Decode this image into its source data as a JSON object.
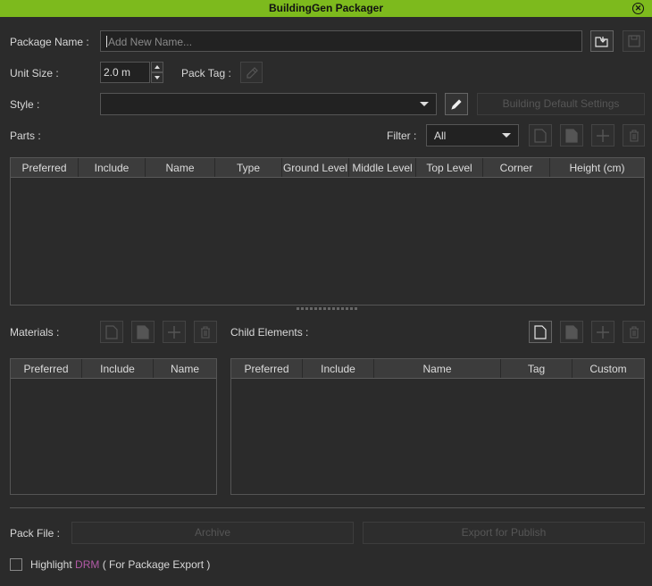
{
  "window": {
    "title": "BuildingGen Packager"
  },
  "package_name": {
    "label": "Package Name :",
    "placeholder": "Add New Name..."
  },
  "unit_size": {
    "label": "Unit Size :",
    "value": "2.0 m"
  },
  "pack_tag": {
    "label": "Pack Tag :"
  },
  "style": {
    "label": "Style :",
    "value": ""
  },
  "building_default_settings": {
    "label": "Building Default Settings"
  },
  "parts": {
    "label": "Parts :",
    "filter_label": "Filter :",
    "filter_value": "All",
    "columns": [
      "Preferred",
      "Include",
      "Name",
      "Type",
      "Ground Level",
      "Middle Level",
      "Top Level",
      "Corner",
      "Height (cm)"
    ]
  },
  "materials": {
    "label": "Materials :",
    "columns": [
      "Preferred",
      "Include",
      "Name"
    ]
  },
  "child_elements": {
    "label": "Child Elements :",
    "columns": [
      "Preferred",
      "Include",
      "Name",
      "Tag",
      "Custom"
    ]
  },
  "pack_file": {
    "label": "Pack File :",
    "archive_label": "Archive",
    "export_label": "Export for Publish"
  },
  "highlight": {
    "prefix": "Highlight ",
    "drm": "DRM",
    "suffix": " ( For Package Export )",
    "checked": false
  },
  "colors": {
    "title_bar": "#7dba1d",
    "background": "#2b2b2b",
    "drm_accent": "#b35aa7"
  }
}
